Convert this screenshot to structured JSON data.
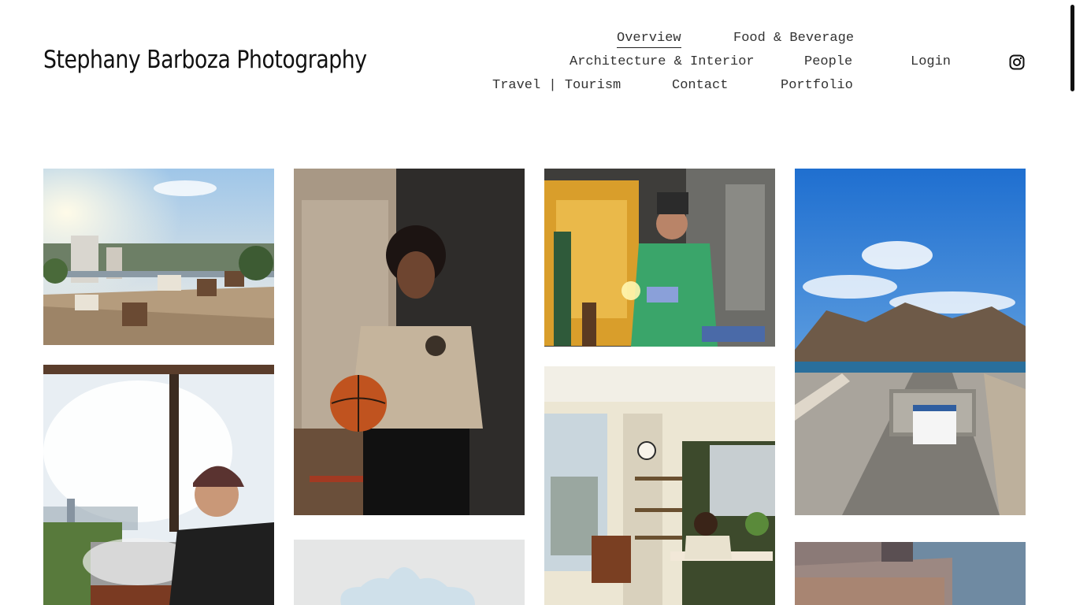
{
  "site": {
    "title": "Stephany Barboza Photography"
  },
  "nav": {
    "items": [
      {
        "label": "Overview",
        "active": true
      },
      {
        "label": "Food & Beverage"
      },
      {
        "label": "Architecture & Interior"
      },
      {
        "label": "People"
      },
      {
        "label": "Login"
      },
      {
        "label": "Travel | Tourism"
      },
      {
        "label": "Contact"
      },
      {
        "label": "Portfolio"
      }
    ],
    "instagram_icon": "instagram-icon"
  },
  "gallery": {
    "photos": [
      {
        "name": "photo-rooftop-terrace"
      },
      {
        "name": "photo-boy-basketball"
      },
      {
        "name": "photo-welder"
      },
      {
        "name": "photo-harbor-mountains"
      },
      {
        "name": "photo-chef-grill"
      },
      {
        "name": "photo-cloud-cutout"
      },
      {
        "name": "photo-office-kitchen"
      },
      {
        "name": "photo-building-facade"
      }
    ]
  }
}
